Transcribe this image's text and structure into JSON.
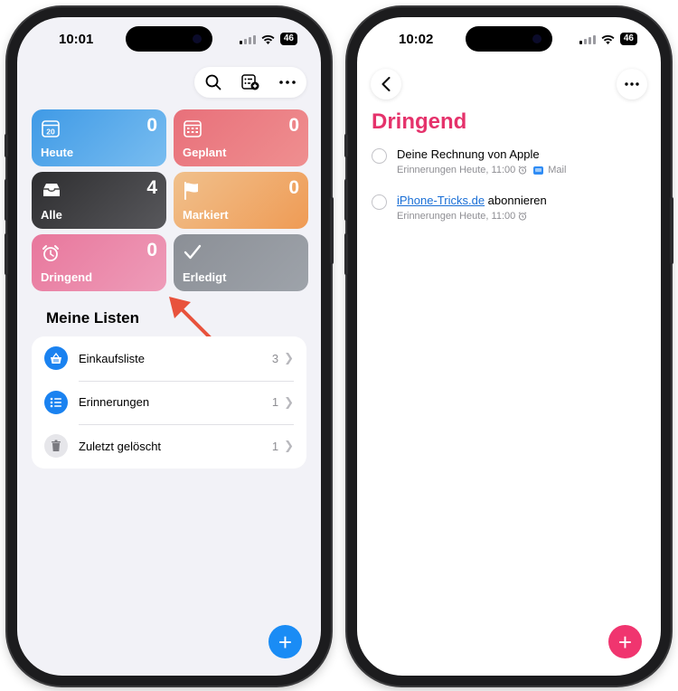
{
  "left": {
    "status": {
      "time": "10:01",
      "battery": "46"
    },
    "tiles": [
      {
        "label": "Heute",
        "count": "0",
        "icon": "calendar-day-icon",
        "day": "20"
      },
      {
        "label": "Geplant",
        "count": "0",
        "icon": "calendar-icon"
      },
      {
        "label": "Alle",
        "count": "4",
        "icon": "tray-icon"
      },
      {
        "label": "Markiert",
        "count": "0",
        "icon": "flag-icon"
      },
      {
        "label": "Dringend",
        "count": "0",
        "icon": "alarm-icon"
      },
      {
        "label": "Erledigt",
        "count": "",
        "icon": "checkmark-icon"
      }
    ],
    "lists_heading": "Meine Listen",
    "lists": [
      {
        "name": "Einkaufsliste",
        "count": "3",
        "icon": "basket-icon"
      },
      {
        "name": "Erinnerungen",
        "count": "1",
        "icon": "list-icon"
      },
      {
        "name": "Zuletzt gelöscht",
        "count": "1",
        "icon": "trash-icon"
      }
    ]
  },
  "right": {
    "status": {
      "time": "10:02",
      "battery": "46"
    },
    "title": "Dringend",
    "tasks": [
      {
        "title": "Deine Rechnung von Apple",
        "list": "Erinnerungen",
        "date": "Heute, 11:00",
        "attachment": "Mail"
      },
      {
        "title_link": "iPhone-Tricks.de",
        "title_rest": " abonnieren",
        "list": "Erinnerungen",
        "date": "Heute, 11:00"
      }
    ]
  },
  "colors": {
    "accent_pink": "#e5326b",
    "accent_blue": "#1a8cf5",
    "annotation_arrow": "#e8523c"
  }
}
